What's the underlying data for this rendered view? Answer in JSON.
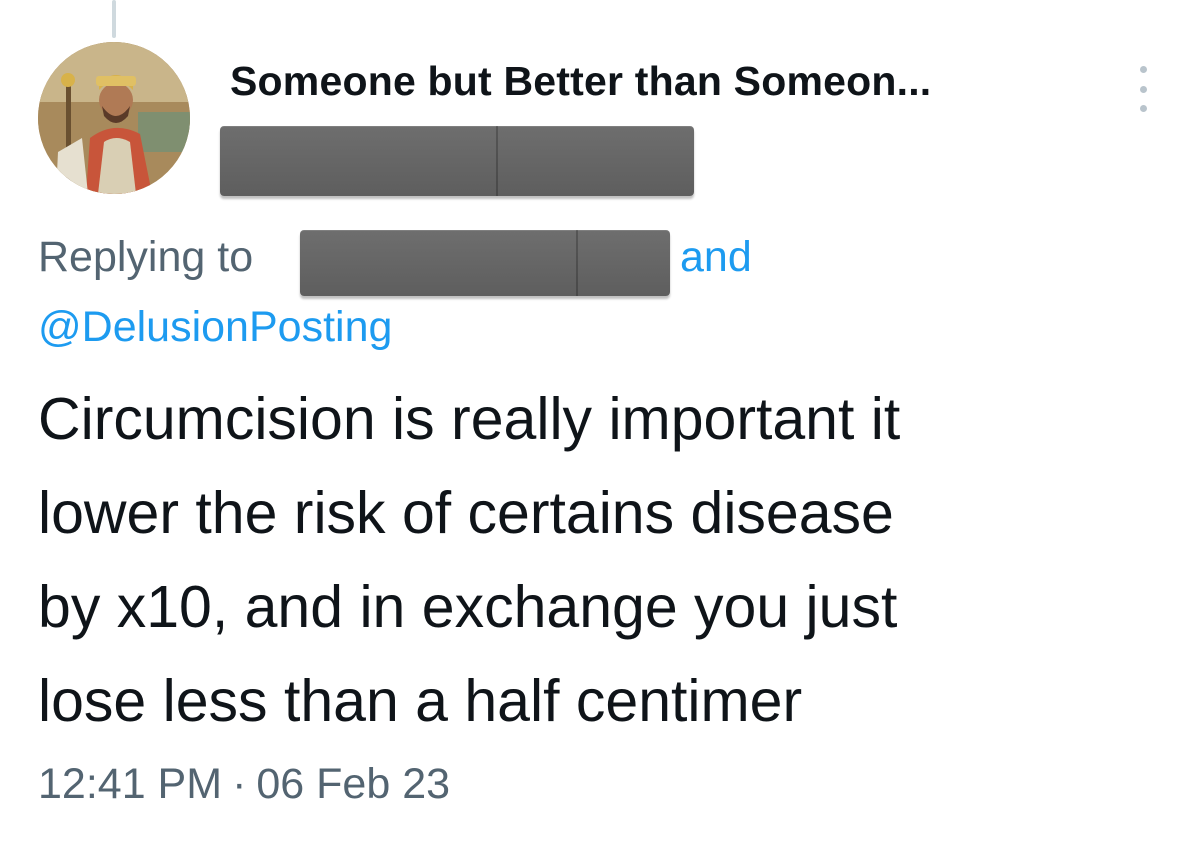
{
  "tweet": {
    "display_name": "Someone but Better than Someon...",
    "replying_prefix": "Replying to",
    "replying_and": "and",
    "replying_mention": "@DelusionPosting",
    "body_lines": [
      "Circumcision is really important it",
      "lower the risk of certains disease",
      "by x10, and in exchange you just",
      "lose less than a half centimer"
    ],
    "time": "12:41 PM",
    "separator": "·",
    "date": "06 Feb 23"
  },
  "icons": {
    "more": "more-vertical-icon",
    "avatar": "avatar-painting"
  },
  "colors": {
    "text_primary": "#0f1419",
    "text_secondary": "#536471",
    "link": "#1d9bf0",
    "redaction": "#666666"
  }
}
